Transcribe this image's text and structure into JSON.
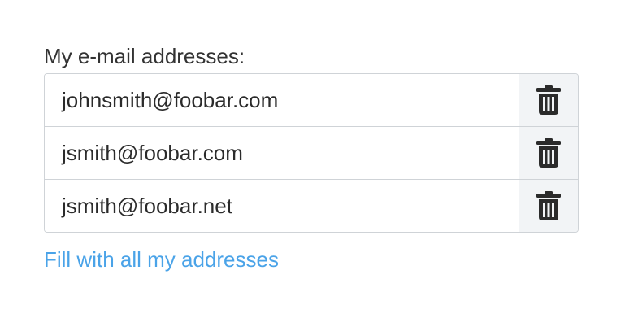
{
  "form": {
    "label": "My e-mail addresses:",
    "emails": [
      {
        "value": "johnsmith@foobar.com",
        "action_icon": "trash-icon"
      },
      {
        "value": "jsmith@foobar.com",
        "action_icon": "trash-icon"
      },
      {
        "value": "jsmith@foobar.net",
        "action_icon": "trash-icon"
      }
    ],
    "fill_link": "Fill with all my addresses"
  },
  "colors": {
    "link": "#4aa3e8",
    "border": "#cfd3d7",
    "button_bg": "#f2f4f6",
    "icon": "#2b2b2b"
  }
}
